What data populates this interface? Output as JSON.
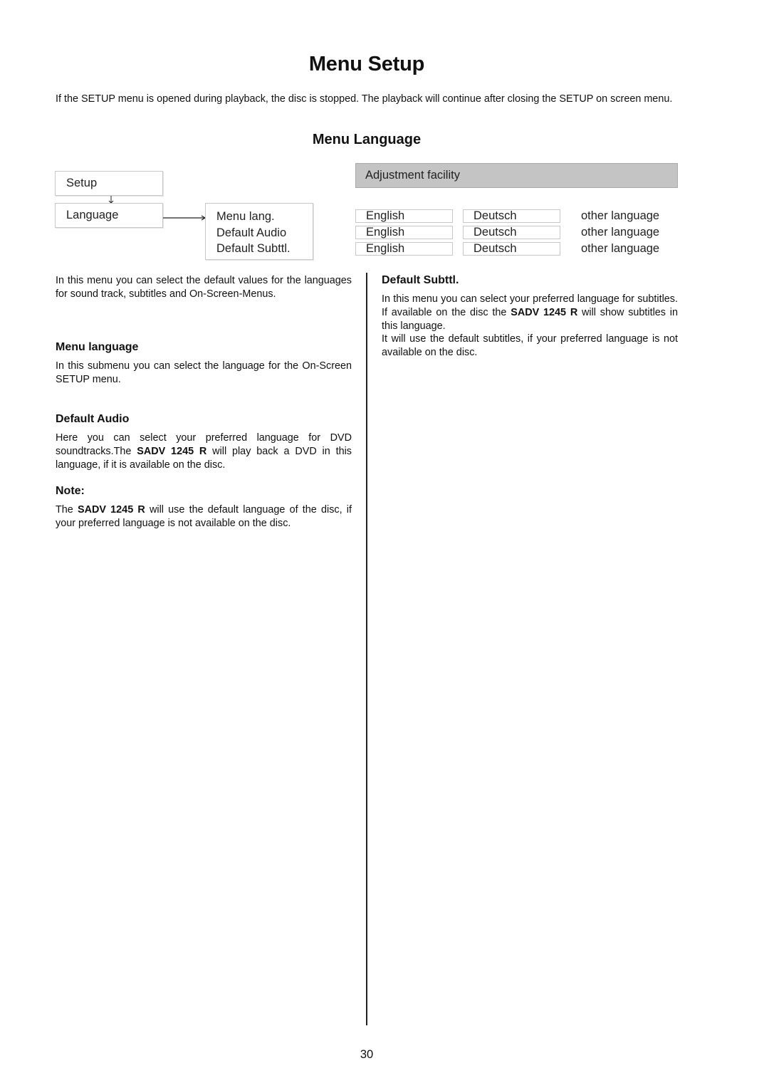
{
  "page": {
    "title": "Menu Setup",
    "intro": "If the SETUP menu is opened during playback, the disc is stopped. The playback will continue after closing the SETUP on screen menu.",
    "section_title": "Menu Language",
    "page_number": "30"
  },
  "diagram": {
    "setup_label": "Setup",
    "language_label": "Language",
    "submenu_items": [
      "Menu lang.",
      "Default Audio",
      "Default Subttl."
    ],
    "adjustment_header": "Adjustment facility",
    "options_rows": [
      {
        "first": "English",
        "second": "Deutsch",
        "third": "other language"
      },
      {
        "first": "English",
        "second": "Deutsch",
        "third": "other language"
      },
      {
        "first": "English",
        "second": "Deutsch",
        "third": "other language"
      }
    ],
    "header_bg": "#c4c4c4"
  },
  "left_column": {
    "intro": "In this menu you can select the default values for the languages for sound track, subtitles and On-Screen-Menus.",
    "menu_language": {
      "heading": "Menu language",
      "body": "In this submenu you can select the language for the On-Screen SETUP menu."
    },
    "default_audio": {
      "heading": "Default Audio",
      "body_before": "Here you can select your preferred language for DVD soundtracks.The ",
      "model": "SADV 1245 R",
      "body_after": " will play back a DVD in this language, if it is available on the disc."
    },
    "note": {
      "heading": "Note:",
      "body_before": "The ",
      "model": "SADV 1245 R",
      "body_after": " will use the default language of the disc, if your preferred language is not available on the disc."
    }
  },
  "right_column": {
    "default_subttl": {
      "heading": "Default Subttl.",
      "body_before": "In this menu you can select your preferred language for subtitles. If available on the disc the ",
      "model": "SADV 1245 R",
      "body_after": " will show subtitles in this language.",
      "body2": "It will use the default subtitles, if your preferred language is not available on the disc."
    }
  }
}
